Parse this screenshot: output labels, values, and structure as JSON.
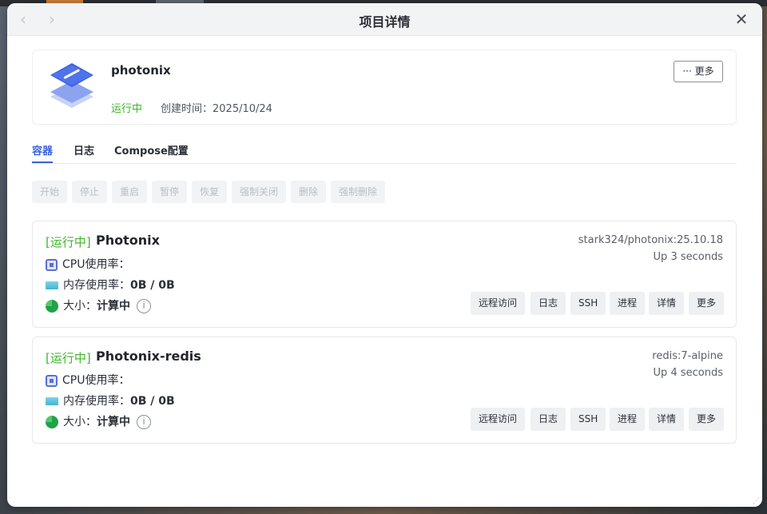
{
  "window": {
    "title": "项目详情",
    "back_icon": "chevron-left-icon",
    "forward_icon": "chevron-right-icon",
    "close_icon": "close-icon"
  },
  "project": {
    "name": "photonix",
    "status": "运行中",
    "created": "创建时间：2025/10/24",
    "more_label": "··· 更多",
    "logo_icon": "stacked-layers-logo",
    "status_color": "#3fb52c"
  },
  "tabs": [
    {
      "label": "容器",
      "active": true
    },
    {
      "label": "日志",
      "active": false
    },
    {
      "label": "Compose配置",
      "active": false
    }
  ],
  "actions": [
    "开始",
    "停止",
    "重启",
    "暂停",
    "恢复",
    "强制关闭",
    "删除",
    "强制删除"
  ],
  "containers": [
    {
      "status": "[运行中]",
      "name": "Photonix",
      "image": "stark324/photonix:25.10.18",
      "uptime": "Up 3 seconds",
      "cpu_label": "CPU使用率：",
      "cpu_value": "",
      "mem_label": "内存使用率：",
      "mem_value": "0B / 0B",
      "size_label": "大小：",
      "size_value": "计算中",
      "buttons": [
        "远程访问",
        "日志",
        "SSH",
        "进程",
        "详情",
        "更多"
      ]
    },
    {
      "status": "[运行中]",
      "name": "Photonix-redis",
      "image": "redis:7-alpine",
      "uptime": "Up 4 seconds",
      "cpu_label": "CPU使用率：",
      "cpu_value": "",
      "mem_label": "内存使用率：",
      "mem_value": "0B / 0B",
      "size_label": "大小：",
      "size_value": "计算中",
      "buttons": [
        "远程访问",
        "日志",
        "SSH",
        "进程",
        "详情",
        "更多"
      ]
    }
  ],
  "colors": {
    "accent": "#3763e0",
    "running": "#3fb52c"
  }
}
